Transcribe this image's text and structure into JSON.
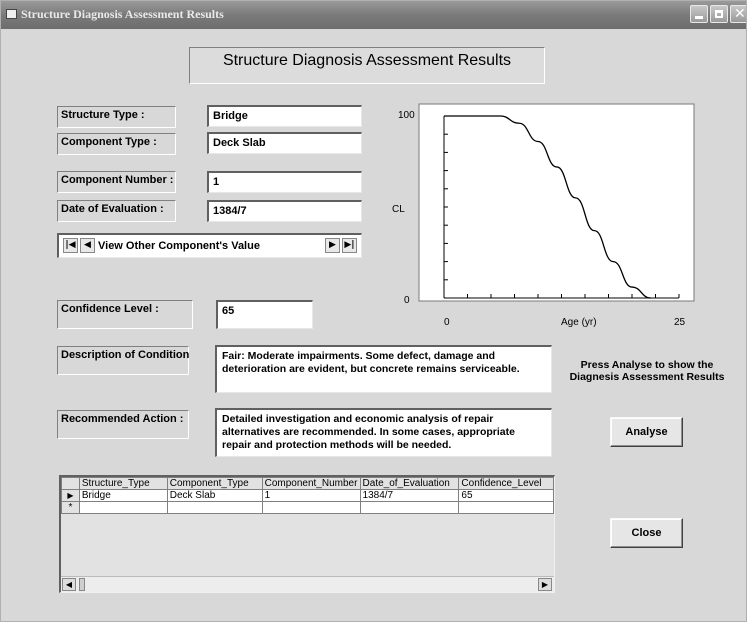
{
  "window": {
    "title": "Structure Diagnosis Assessment Results"
  },
  "header": {
    "title": "Structure Diagnosis Assessment Results"
  },
  "fields": {
    "structure_type": {
      "label": "Structure Type :",
      "value": "Bridge"
    },
    "component_type": {
      "label": "Component Type :",
      "value": "Deck Slab"
    },
    "component_number": {
      "label": "Component Number :",
      "value": "1"
    },
    "date_of_evaluation": {
      "label": "Date of Evaluation :",
      "value": "1384/7"
    },
    "confidence_level": {
      "label": "Confidence Level :",
      "value": "65"
    },
    "description": {
      "label": "Description of Condition",
      "value": "Fair: Moderate impairments. Some defect, damage and deterioration are evident, but concrete remains serviceable."
    },
    "recommended_action": {
      "label": "Recommended Action :",
      "value": "Detailed investigation and economic analysis of repair alternatives are recommended. In some cases, appropriate repair and protection methods will be needed."
    }
  },
  "navigator": {
    "label": "View Other Component's Value",
    "first_icon": "first-record-icon",
    "prev_icon": "prev-record-icon",
    "next_icon": "next-record-icon",
    "last_icon": "last-record-icon"
  },
  "chart_data": {
    "type": "line",
    "title": "",
    "xlabel": "Age (yr)",
    "ylabel": "CL",
    "xlim": [
      0,
      25
    ],
    "ylim": [
      0,
      100
    ],
    "x_tick_labels": [
      "0",
      "25"
    ],
    "y_tick_labels": [
      "0",
      "100"
    ],
    "grid": false,
    "series": [
      {
        "x": [
          0,
          2,
          4,
          6,
          8,
          10,
          12,
          14,
          16,
          18,
          20,
          22
        ],
        "y": [
          100,
          100,
          100,
          100,
          96,
          86,
          72,
          55,
          37,
          20,
          6,
          0
        ]
      }
    ]
  },
  "prompt_text": "Press Analyse to show the Diagnesis Assessment Results",
  "buttons": {
    "analyse": "Analyse",
    "close": "Close"
  },
  "grid": {
    "columns": [
      "Structure_Type",
      "Component_Type",
      "Component_Number",
      "Date_of_Evaluation",
      "Confidence_Level"
    ],
    "rows": [
      [
        "Bridge",
        "Deck Slab",
        "1",
        "1384/7",
        "65"
      ]
    ],
    "current_row_marker": "▶",
    "new_row_marker": "*"
  },
  "colors": {
    "titlebar": "#7a7a7a",
    "window_bg": "#d8d8d8",
    "curve": "#000000"
  }
}
